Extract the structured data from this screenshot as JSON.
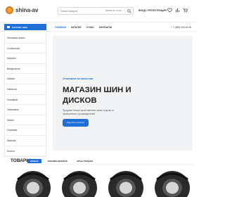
{
  "header": {
    "logo_text": "shina-av",
    "search_placeholder": "Поиск товаров",
    "search_select": "ВЫБРАТЬ КАТЕГ...",
    "login_label": "ВХОД / РЕГИСТРАЦИЯ",
    "icons": [
      "heart-icon",
      "compare-icon",
      "cart-icon"
    ]
  },
  "nav": {
    "catalog_label": "КАТАЛОГ ШИН",
    "links": [
      "ГЛАВНАЯ",
      "КАТАЛОГ",
      "О НАС",
      "КОНТАКТЫ"
    ],
    "phone": "+ 7 (999) 000-00-00"
  },
  "sidebar": {
    "items": [
      "Легковые шины",
      "Continental",
      "Michelin",
      "Bridgestone",
      "Nokian",
      "Hankook",
      "Goodyear",
      "Yokohama",
      "Nexen",
      "Goodride",
      "Marshal",
      "Kumho"
    ]
  },
  "hero": {
    "subtitle": "Отвечаем за качество",
    "title_line1": "МАГАЗИН ШИН И",
    "title_line2": "ДИСКОВ",
    "desc_line1": "Продаем только качественные шины и диски от",
    "desc_line2": "проверенных производителей",
    "button_label": "Перейти в каталог"
  },
  "products": {
    "title": "ТОВАРЫ",
    "tabs": [
      "НОВЫЕ",
      "РЕКОМЕНДУЕМЫЕ",
      "ХИТЫ ПРОДАЖ"
    ]
  },
  "colors": {
    "accent": "#1f6fd8",
    "logo": "#f29f3d",
    "hero_bg": "#f1f3f5"
  }
}
